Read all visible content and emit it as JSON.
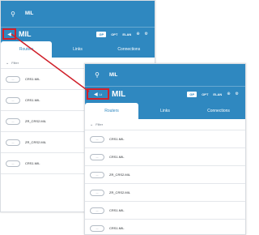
{
  "colors": {
    "header": "#2f88c0",
    "highlight": "#d0202a",
    "divider": "#e4e7eb"
  },
  "icons": {
    "search": "search-icon",
    "back": "back-arrow-icon",
    "add": "add-icon",
    "settings": "settings-icon",
    "filter_toggle": "chevron-down-icon"
  },
  "back_panel": {
    "search_value": "MIL",
    "title": "MIL",
    "badge": "GP",
    "action_opt": "OPT",
    "action_elan": "ELAN",
    "tabs": [
      "Routers",
      "Links",
      "Connections"
    ],
    "filter_label": "Filter",
    "items": [
      "CRS1.MIL",
      "CRS1.MIL",
      "ZR_CRS2.MIL",
      "ZR_CRS2.MIL",
      "CRS1.MIL"
    ]
  },
  "front_panel": {
    "search_value": "MIL",
    "back_label": "Lt",
    "title": "MIL",
    "badge": "GP",
    "action_opt": "OPT",
    "action_elan": "ELAN",
    "tabs": [
      "Routers",
      "Links",
      "Connections"
    ],
    "filter_label": "Filter",
    "items": [
      "CRS1.MIL",
      "CRS1.MIL",
      "ZR_CRS2.MIL",
      "ZR_CRS2.MIL",
      "CRS1.MIL",
      "CRS1.MIL"
    ]
  }
}
